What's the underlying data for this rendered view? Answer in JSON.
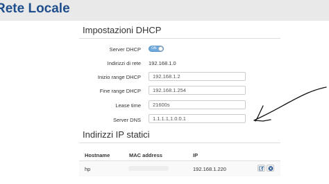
{
  "header": {
    "title": "Rete Locale"
  },
  "dhcp": {
    "section_title": "Impostazioni DHCP",
    "server_label": "Server DHCP",
    "toggle_text": "ON",
    "network_label": "Indirizzi di rete",
    "network_value": "192.168.1.0",
    "range_start_label": "Inizio range DHCP",
    "range_start_value": "192.168.1.2",
    "range_end_label": "Fine range DHCP",
    "range_end_value": "192.168.1.254",
    "lease_label": "Lease time",
    "lease_value": "21600s",
    "dns_label": "Server DNS",
    "dns_value": "1.1.1.1,1.0.0.1"
  },
  "static_ips": {
    "section_title": "Indirizzi IP statici",
    "columns": [
      "Hostname",
      "MAC address",
      "IP"
    ],
    "rows": [
      {
        "hostname": "hp",
        "ip": "192.168.1.220"
      }
    ]
  },
  "icons": {
    "edit": "edit-icon",
    "delete": "delete-icon"
  },
  "colors": {
    "title": "#1f4e8c",
    "toggle_on": "#6fa8dc",
    "delete": "#1f4e8c"
  }
}
